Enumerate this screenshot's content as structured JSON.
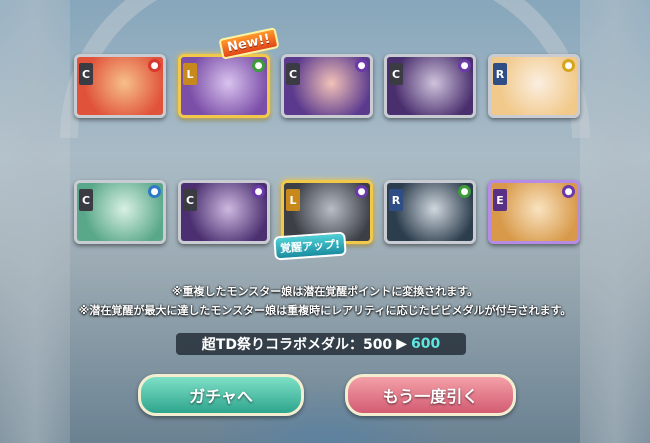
{
  "cards_row1": [
    {
      "rarity": "C",
      "element": "fire-element-icon",
      "elementGlyph": "●",
      "frame": "silver",
      "colors": [
        "#e0523a",
        "#f6c08a"
      ]
    },
    {
      "rarity": "L",
      "element": "wind-element-icon",
      "elementGlyph": "●",
      "frame": "gold",
      "colors": [
        "#7b4ea8",
        "#d9c3ee"
      ]
    },
    {
      "rarity": "C",
      "element": "dark-element-icon",
      "elementGlyph": "●",
      "frame": "silver",
      "colors": [
        "#5b3a8e",
        "#f2c2b8"
      ]
    },
    {
      "rarity": "C",
      "element": "dark-element-icon",
      "elementGlyph": "●",
      "frame": "silver",
      "colors": [
        "#4a2f6e",
        "#cfc3dc"
      ]
    },
    {
      "rarity": "R",
      "element": "light-element-icon",
      "elementGlyph": "●",
      "frame": "silver",
      "colors": [
        "#f1c98a",
        "#fbeee0"
      ]
    }
  ],
  "cards_row2": [
    {
      "rarity": "C",
      "element": "water-element-icon",
      "elementGlyph": "●",
      "frame": "silver",
      "colors": [
        "#5aa88a",
        "#d8f0e3"
      ]
    },
    {
      "rarity": "C",
      "element": "dark-element-icon",
      "elementGlyph": "●",
      "frame": "silver",
      "colors": [
        "#4b2f70",
        "#cdb9e0"
      ]
    },
    {
      "rarity": "L",
      "element": "dark-element-icon",
      "elementGlyph": "●",
      "frame": "gold",
      "colors": [
        "#3c3f46",
        "#b9bec6"
      ]
    },
    {
      "rarity": "R",
      "element": "wind-element-icon",
      "elementGlyph": "●",
      "frame": "silver",
      "colors": [
        "#2c3d4d",
        "#d0d7de"
      ]
    },
    {
      "rarity": "E",
      "element": "dark-element-icon",
      "elementGlyph": "●",
      "frame": "purple",
      "colors": [
        "#d89a4a",
        "#f9e3c0"
      ]
    }
  ],
  "badges": {
    "new": "New!!",
    "awaken": "覚醒アップ!"
  },
  "notes": {
    "line1": "※重複したモンスター娘は潜在覚醒ポイントに変換されます。",
    "line2": "※潜在覚醒が最大に達したモンスター娘は重複時にレアリティに応じたビビメダルが付与されます。"
  },
  "medal": {
    "label": "超TD祭りコラボメダル：500",
    "arrow": "▶",
    "new_value": "600"
  },
  "buttons": {
    "gacha": "ガチャへ",
    "again": "もう一度引く"
  },
  "colors": {
    "gacha_button": "#2fa58e",
    "again_button": "#d35b72",
    "medal_new_value": "#5fe6e0"
  }
}
